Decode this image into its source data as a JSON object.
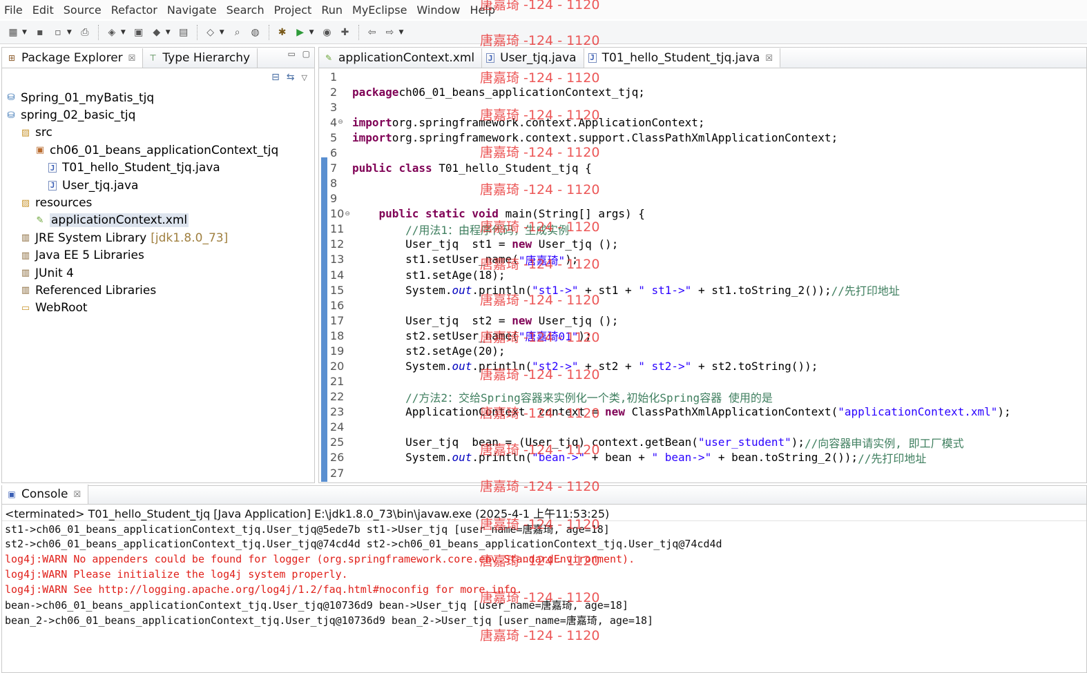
{
  "menu": [
    "File",
    "Edit",
    "Source",
    "Refactor",
    "Navigate",
    "Search",
    "Project",
    "Run",
    "MyEclipse",
    "Window",
    "Help"
  ],
  "toolbar": {
    "icons": [
      "new-icon",
      "save-icon",
      "save-all-icon",
      "print-icon",
      "new-web-project-icon",
      "package-icon",
      "deploy-icon",
      "server-icon",
      "open-type-icon",
      "search-icon",
      "open-perspective-icon",
      "debug-icon",
      "run-icon",
      "coverage-icon",
      "external-tools-icon",
      "back-icon",
      "forward-icon"
    ]
  },
  "explorer": {
    "tabs": [
      {
        "label": "Package Explorer",
        "icon": "package-explorer-icon"
      },
      {
        "label": "Type Hierarchy",
        "icon": "type-hierarchy-icon"
      }
    ],
    "tree": [
      {
        "label": "Spring_01_myBatis_tjq",
        "icon": "project-icon",
        "level": 1
      },
      {
        "label": "spring_02_basic_tjq",
        "icon": "project-icon",
        "level": 1
      },
      {
        "label": "src",
        "icon": "source-folder-icon",
        "level": 2
      },
      {
        "label": "ch06_01_beans_applicationContext_tjq",
        "icon": "package-icon",
        "level": 3
      },
      {
        "label": "T01_hello_Student_tjq.java",
        "icon": "java-file-icon",
        "level": 4
      },
      {
        "label": "User_tjq.java",
        "icon": "java-file-icon",
        "level": 4
      },
      {
        "label": "resources",
        "icon": "source-folder-icon",
        "level": 2
      },
      {
        "label": "applicationContext.xml",
        "icon": "xml-file-icon",
        "level": 3,
        "selected": true
      },
      {
        "label": "JRE System Library",
        "suffix": "[jdk1.8.0_73]",
        "icon": "library-icon",
        "level": 2
      },
      {
        "label": "Java EE 5 Libraries",
        "icon": "library-icon",
        "level": 2
      },
      {
        "label": "JUnit 4",
        "icon": "library-icon",
        "level": 2
      },
      {
        "label": "Referenced Libraries",
        "icon": "library-icon",
        "level": 2
      },
      {
        "label": "WebRoot",
        "icon": "folder-icon",
        "level": 2
      }
    ]
  },
  "editor": {
    "tabs": [
      {
        "label": "applicationContext.xml",
        "icon": "xml-file-icon",
        "active": false
      },
      {
        "label": "User_tjq.java",
        "icon": "java-file-icon",
        "active": false
      },
      {
        "label": "T01_hello_Student_tjq.java",
        "icon": "java-file-icon",
        "active": true
      }
    ],
    "lines": [
      {
        "n": "1",
        "tokens": []
      },
      {
        "n": "2",
        "tokens": [
          [
            "kw",
            "package"
          ],
          [
            "",
            "ch06_01_beans_applicationContext_tjq;"
          ]
        ]
      },
      {
        "n": "3",
        "tokens": []
      },
      {
        "n": "4",
        "fold": true,
        "tokens": [
          [
            "kw",
            "import"
          ],
          [
            "",
            "org.springframework.context.ApplicationContext;"
          ]
        ]
      },
      {
        "n": "5",
        "tokens": [
          [
            "kw",
            "import"
          ],
          [
            "",
            "org.springframework.context.support.ClassPathXmlApplicationContext;"
          ]
        ]
      },
      {
        "n": "6",
        "tokens": []
      },
      {
        "n": "7",
        "tokens": [
          [
            "kw",
            "public"
          ],
          [
            "",
            " "
          ],
          [
            "kw",
            "class"
          ],
          [
            "",
            " T01_hello_Student_tjq {"
          ]
        ]
      },
      {
        "n": "8",
        "tokens": []
      },
      {
        "n": "9",
        "tokens": []
      },
      {
        "n": "10",
        "fold": true,
        "tokens": [
          [
            "",
            "    "
          ],
          [
            "kw",
            "public"
          ],
          [
            "",
            " "
          ],
          [
            "kw",
            "static"
          ],
          [
            "",
            " "
          ],
          [
            "kw",
            "void"
          ],
          [
            "",
            " main(String[] args) {"
          ]
        ]
      },
      {
        "n": "11",
        "tokens": [
          [
            "",
            "        "
          ],
          [
            "cmt",
            "//用法1：由程序代码，生成实例"
          ]
        ]
      },
      {
        "n": "12",
        "tokens": [
          [
            "",
            "        User_tjq  st1 = "
          ],
          [
            "kw",
            "new"
          ],
          [
            "",
            " User_tjq ();"
          ]
        ]
      },
      {
        "n": "13",
        "tokens": [
          [
            "",
            "        st1.setUser_name("
          ],
          [
            "str",
            "\"唐嘉琦\""
          ],
          [
            "",
            ");"
          ]
        ]
      },
      {
        "n": "14",
        "tokens": [
          [
            "",
            "        st1.setAge(18);"
          ]
        ]
      },
      {
        "n": "15",
        "tokens": [
          [
            "",
            "        System."
          ],
          [
            "fld",
            "out"
          ],
          [
            "",
            ".println("
          ],
          [
            "str",
            "\"st1->\""
          ],
          [
            "",
            " + st1 + "
          ],
          [
            "str",
            "\" st1->\""
          ],
          [
            "",
            " + st1.toString_2());"
          ],
          [
            "cmt",
            "//先打印地址"
          ]
        ]
      },
      {
        "n": "16",
        "tokens": []
      },
      {
        "n": "17",
        "tokens": [
          [
            "",
            "        User_tjq  st2 = "
          ],
          [
            "kw",
            "new"
          ],
          [
            "",
            " User_tjq ();"
          ]
        ]
      },
      {
        "n": "18",
        "tokens": [
          [
            "",
            "        st2.setUser_name("
          ],
          [
            "str",
            "\"唐嘉琦01\""
          ],
          [
            "",
            ");"
          ]
        ]
      },
      {
        "n": "19",
        "tokens": [
          [
            "",
            "        st2.setAge(20);"
          ]
        ]
      },
      {
        "n": "20",
        "tokens": [
          [
            "",
            "        System."
          ],
          [
            "fld",
            "out"
          ],
          [
            "",
            ".println("
          ],
          [
            "str",
            "\"st2->\""
          ],
          [
            "",
            " + st2 + "
          ],
          [
            "str",
            "\" st2->\""
          ],
          [
            "",
            " + st2.toString());"
          ]
        ]
      },
      {
        "n": "21",
        "tokens": []
      },
      {
        "n": "22",
        "tokens": [
          [
            "",
            "        "
          ],
          [
            "cmt",
            "//方法2：交给Spring容器来实例化一个类,初始化Spring容器 使用的是"
          ]
        ]
      },
      {
        "n": "23",
        "tokens": [
          [
            "",
            "        ApplicationContext  context = "
          ],
          [
            "kw",
            "new"
          ],
          [
            "",
            " ClassPathXmlApplicationContext("
          ],
          [
            "str",
            "\"applicationContext.xml\""
          ],
          [
            "",
            ");"
          ]
        ]
      },
      {
        "n": "24",
        "tokens": []
      },
      {
        "n": "25",
        "tokens": [
          [
            "",
            "        User_tjq  bean = (User_tjq) context.getBean("
          ],
          [
            "str",
            "\"user_student\""
          ],
          [
            "",
            ");"
          ],
          [
            "cmt",
            "//向容器申请实例, 即工厂模式"
          ]
        ]
      },
      {
        "n": "26",
        "tokens": [
          [
            "",
            "        System."
          ],
          [
            "fld",
            "out"
          ],
          [
            "",
            ".println("
          ],
          [
            "str",
            "\"bean->\""
          ],
          [
            "",
            " + bean + "
          ],
          [
            "str",
            "\" bean->\""
          ],
          [
            "",
            " + bean.toString_2());"
          ],
          [
            "cmt",
            "//先打印地址"
          ]
        ]
      },
      {
        "n": "27",
        "tokens": []
      }
    ]
  },
  "console": {
    "tab": {
      "label": "Console",
      "icon": "console-icon"
    },
    "status": "<terminated> T01_hello_Student_tjq [Java Application] E:\\jdk1.8.0_73\\bin\\javaw.exe (2025-4-1 上午11:53:25)",
    "lines": [
      {
        "text": "st1->ch06_01_beans_applicationContext_tjq.User_tjq@5ede7b st1->User_tjq [user_name=唐嘉琦, age=18]",
        "type": "out"
      },
      {
        "text": "st2->ch06_01_beans_applicationContext_tjq.User_tjq@74cd4d st2->ch06_01_beans_applicationContext_tjq.User_tjq@74cd4d",
        "type": "out"
      },
      {
        "text": "log4j:WARN No appenders could be found for logger (org.springframework.core.env.StandardEnvironment).",
        "type": "err"
      },
      {
        "text": "log4j:WARN Please initialize the log4j system properly.",
        "type": "err"
      },
      {
        "text": "log4j:WARN See http://logging.apache.org/log4j/1.2/faq.html#noconfig for more info.",
        "type": "err"
      },
      {
        "text": "bean->ch06_01_beans_applicationContext_tjq.User_tjq@10736d9 bean->User_tjq [user_name=唐嘉琦, age=18]",
        "type": "out"
      },
      {
        "text": "bean_2->ch06_01_beans_applicationContext_tjq.User_tjq@10736d9 bean_2->User_tjq [user_name=唐嘉琦, age=18]",
        "type": "out"
      }
    ]
  },
  "watermark": "唐嘉琦 -124 - 1120"
}
